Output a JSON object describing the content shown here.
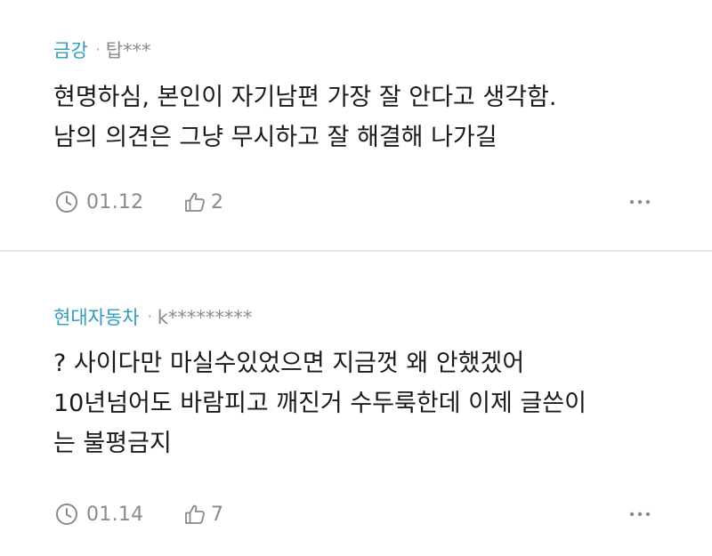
{
  "comments": [
    {
      "company": "금강",
      "separator": "·",
      "user": "탑***",
      "lines": [
        "현명하심, 본인이 자기남편 가장 잘 안다고 생각함.",
        "남의 의견은 그냥 무시하고 잘 해결해 나가길"
      ],
      "date": "01.12",
      "likes": "2",
      "icons": {
        "time": "clock-icon",
        "like": "thumbs-up-icon",
        "more": "more-icon"
      }
    },
    {
      "company": "현대자동차",
      "separator": "·",
      "user": "k*********",
      "lines": [
        "? 사이다만 마실수있었으면 지금껏 왜 안했겠어",
        "10년넘어도 바람피고 깨진거 수두룩한데 이제 글쓴이",
        "는 불평금지"
      ],
      "date": "01.14",
      "likes": "7",
      "icons": {
        "time": "clock-icon",
        "like": "thumbs-up-icon",
        "more": "more-icon"
      }
    }
  ],
  "colors": {
    "company": "#2e9bc0",
    "meta_gray": "#8a8a8a",
    "text": "#1a1a1a",
    "divider": "#e6e6e6"
  }
}
